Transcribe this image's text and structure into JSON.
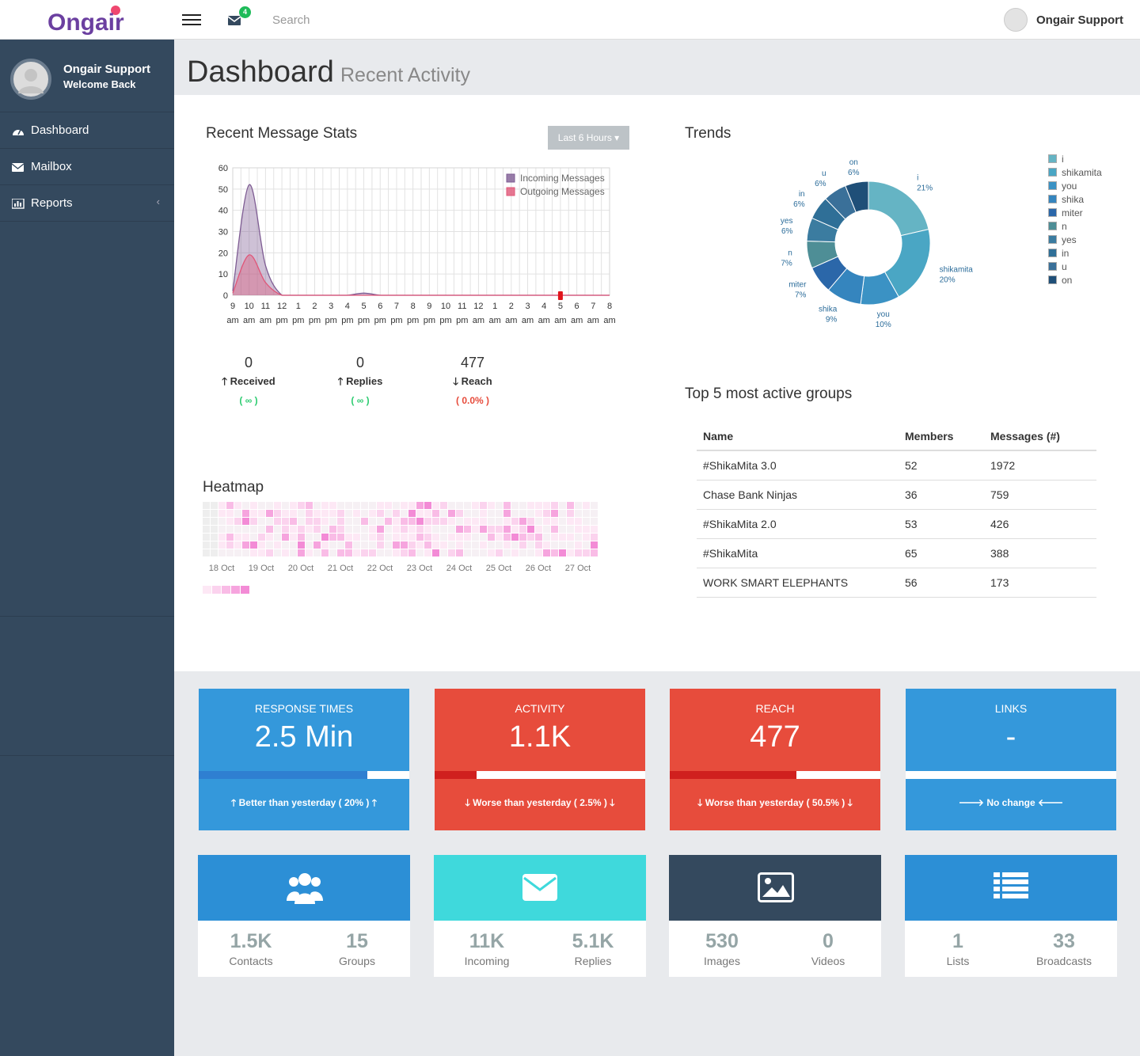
{
  "topbar": {
    "logo_text": "Ongair",
    "mail_badge": "4",
    "search_placeholder": "Search",
    "user_name": "Ongair Support"
  },
  "sidebar": {
    "user_name": "Ongair Support",
    "welcome": "Welcome Back",
    "items": [
      {
        "label": "Dashboard",
        "icon": "dashboard-icon"
      },
      {
        "label": "Mailbox",
        "icon": "envelope-icon"
      },
      {
        "label": "Reports",
        "icon": "bar-chart-icon"
      }
    ]
  },
  "page": {
    "title": "Dashboard",
    "subtitle": "Recent Activity"
  },
  "message_stats": {
    "title": "Recent Message Stats",
    "range_button": "Last 6 Hours",
    "stats": [
      {
        "value": "0",
        "label": "Received",
        "change": "( ∞ )",
        "direction": "up",
        "color": "#2ecc71"
      },
      {
        "value": "0",
        "label": "Replies",
        "change": "( ∞ )",
        "direction": "up",
        "color": "#2ecc71"
      },
      {
        "value": "477",
        "label": "Reach",
        "change": "( 0.0% )",
        "direction": "down",
        "color": "#e74c3c"
      }
    ]
  },
  "chart_data": [
    {
      "type": "area",
      "x": [
        "9 am",
        "10 am",
        "11 am",
        "12 pm",
        "1 pm",
        "2 pm",
        "3 pm",
        "4 pm",
        "5 pm",
        "6 pm",
        "7 pm",
        "8 pm",
        "9 pm",
        "10 pm",
        "11 pm",
        "12 am",
        "1 am",
        "2 am",
        "3 am",
        "4 am",
        "5 am",
        "6 am",
        "7 am",
        "8 am"
      ],
      "x_tick_top": [
        "9",
        "10",
        "11",
        "12",
        "1",
        "2",
        "3",
        "4",
        "5",
        "6",
        "7",
        "8",
        "9",
        "10",
        "11",
        "12",
        "1",
        "2",
        "3",
        "4",
        "5",
        "6",
        "7",
        "8"
      ],
      "x_tick_bottom": [
        "am",
        "am",
        "am",
        "pm",
        "pm",
        "pm",
        "pm",
        "pm",
        "pm",
        "pm",
        "pm",
        "pm",
        "pm",
        "pm",
        "pm",
        "am",
        "am",
        "am",
        "am",
        "am",
        "am",
        "am",
        "am",
        "am"
      ],
      "y_ticks": [
        0,
        10,
        20,
        30,
        40,
        50,
        60
      ],
      "ylim": [
        0,
        60
      ],
      "grid": true,
      "legend_position": "top-right",
      "series": [
        {
          "name": "Incoming Messages",
          "color": "#7e5c93",
          "values": [
            2,
            52,
            14,
            0,
            0,
            0,
            0,
            0,
            1,
            0,
            0,
            0,
            0,
            0,
            0,
            0,
            0,
            0,
            0,
            0,
            0,
            0,
            0,
            0
          ]
        },
        {
          "name": "Outgoing Messages",
          "color": "#e05577",
          "values": [
            1,
            19,
            6,
            0,
            0,
            0,
            0,
            0,
            0,
            0,
            0,
            0,
            0,
            0,
            0,
            0,
            0,
            0,
            0,
            0,
            0,
            0,
            0,
            0
          ]
        }
      ]
    },
    {
      "type": "pie",
      "title": "Trends",
      "slices": [
        {
          "label": "i",
          "value": 21,
          "display": "21%",
          "color": "#65b4c4"
        },
        {
          "label": "shikamita",
          "value": 20,
          "display": "20%",
          "color": "#4aa6c4"
        },
        {
          "label": "you",
          "value": 10,
          "display": "10%",
          "color": "#3b92c4"
        },
        {
          "label": "shika",
          "value": 9,
          "display": "9%",
          "color": "#3585be"
        },
        {
          "label": "miter",
          "value": 7,
          "display": "7%",
          "color": "#2b67a9"
        },
        {
          "label": "n",
          "value": 7,
          "display": "7%",
          "color": "#4e8e96"
        },
        {
          "label": "yes",
          "value": 6,
          "display": "6%",
          "color": "#3b7ca0"
        },
        {
          "label": "in",
          "value": 6,
          "display": "6%",
          "color": "#2f6f97"
        },
        {
          "label": "u",
          "value": 6,
          "display": "6%",
          "color": "#3a7099"
        },
        {
          "label": "on",
          "value": 6,
          "display": "6%",
          "color": "#1f4f78"
        }
      ]
    }
  ],
  "heatmap": {
    "title": "Heatmap",
    "days": [
      "18 Oct",
      "19 Oct",
      "20 Oct",
      "21 Oct",
      "22 Oct",
      "23 Oct",
      "24 Oct",
      "25 Oct",
      "26 Oct",
      "27 Oct"
    ],
    "scale_colors": [
      "#fde8f5",
      "#fbd3ee",
      "#f9bce6",
      "#f6a4de",
      "#f38bd6"
    ]
  },
  "trends": {
    "title": "Trends"
  },
  "groups": {
    "title": "Top 5 most active groups",
    "columns": [
      "Name",
      "Members",
      "Messages (#)"
    ],
    "rows": [
      [
        "#ShikaMita 3.0",
        "52",
        "1972"
      ],
      [
        "Chase Bank Ninjas",
        "36",
        "759"
      ],
      [
        "#ShikaMita 2.0",
        "53",
        "426"
      ],
      [
        "#ShikaMita",
        "65",
        "388"
      ],
      [
        "WORK SMART ELEPHANTS",
        "56",
        "173"
      ]
    ]
  },
  "tiles": [
    {
      "title": "RESPONSE TIMES",
      "value": "2.5 Min",
      "footer": "Better than yesterday ( 20% )",
      "direction": "up",
      "progress": 0.8,
      "color": "#3498db",
      "bar_color": "#2f7fd1"
    },
    {
      "title": "ACTIVITY",
      "value": "1.1K",
      "footer": "Worse than yesterday ( 2.5% )",
      "direction": "down",
      "progress": 0.2,
      "color": "#e74c3c",
      "bar_color": "#d0201e"
    },
    {
      "title": "REACH",
      "value": "477",
      "footer": "Worse than yesterday ( 50.5% )",
      "direction": "down",
      "progress": 0.6,
      "color": "#e74c3c",
      "bar_color": "#d0201e"
    },
    {
      "title": "LINKS",
      "value": "-",
      "footer": "No change",
      "direction": "none",
      "progress": 0,
      "color": "#3498db",
      "bar_color": "#2f7fd1"
    }
  ],
  "cards": [
    {
      "icon": "users-icon",
      "color": "#2c8fd6",
      "a_value": "1.5K",
      "a_label": "Contacts",
      "b_value": "15",
      "b_label": "Groups"
    },
    {
      "icon": "envelope-icon",
      "color": "#3fd9dc",
      "a_value": "11K",
      "a_label": "Incoming",
      "b_value": "5.1K",
      "b_label": "Replies"
    },
    {
      "icon": "image-icon",
      "color": "#34495e",
      "a_value": "530",
      "a_label": "Images",
      "b_value": "0",
      "b_label": "Videos"
    },
    {
      "icon": "list-icon",
      "color": "#2c8fd6",
      "a_value": "1",
      "a_label": "Lists",
      "b_value": "33",
      "b_label": "Broadcasts"
    }
  ]
}
